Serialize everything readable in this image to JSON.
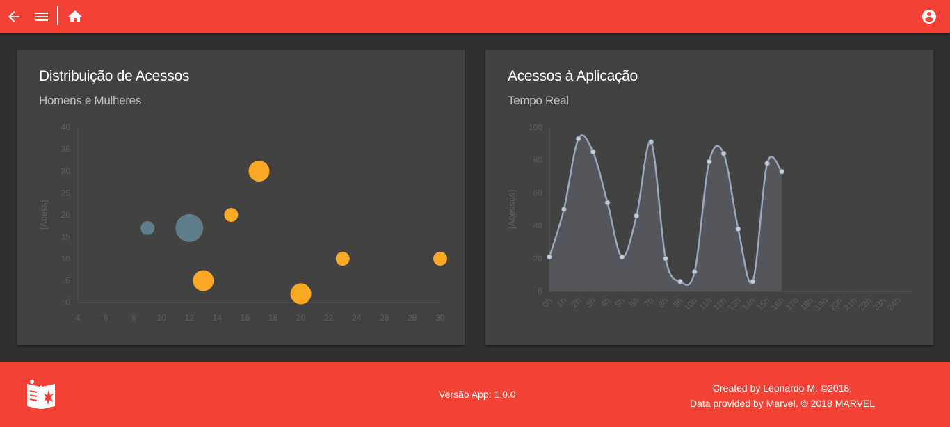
{
  "topbar": {
    "back_icon": "arrow-left-icon",
    "menu_icon": "menu-icon",
    "home_icon": "home-icon",
    "account_icon": "account-circle-icon"
  },
  "cards": {
    "left": {
      "title": "Distribuição de Acessos",
      "subtitle": "Homens e Mulheres"
    },
    "right": {
      "title": "Acessos à Aplicação",
      "subtitle": "Tempo Real"
    }
  },
  "footer": {
    "version": "Versão App: 1.0.0",
    "credit_line1": "Created by Leonardo M. ©2018.",
    "credit_line2": "Data provided by Marvel. © 2018 MARVEL"
  },
  "colors": {
    "primary": "#f44336",
    "card": "#424242",
    "background": "#303030",
    "bubble_blue": "#607d8b",
    "bubble_orange": "#f9a825",
    "line": "#9aa7bd",
    "area": "#54565b"
  },
  "chart_data": [
    {
      "type": "scatter",
      "title": "",
      "xlabel": "",
      "ylabel": "[Acess]",
      "xlim": [
        4,
        30
      ],
      "ylim": [
        0,
        40
      ],
      "x_ticks": [
        "4",
        "6",
        "8",
        "10",
        "12",
        "14",
        "16",
        "18",
        "20",
        "22",
        "24",
        "26",
        "28",
        "30"
      ],
      "y_ticks": [
        "0",
        "5",
        "10",
        "15",
        "20",
        "25",
        "30",
        "35",
        "40"
      ],
      "grid": false,
      "series": [
        {
          "color": "#607d8b",
          "points": [
            {
              "x": 9,
              "y": 17,
              "r": 10
            },
            {
              "x": 12,
              "y": 17,
              "r": 20
            }
          ]
        },
        {
          "color": "#f9a825",
          "points": [
            {
              "x": 13,
              "y": 5,
              "r": 15
            },
            {
              "x": 15,
              "y": 20,
              "r": 10
            },
            {
              "x": 17,
              "y": 30,
              "r": 15
            },
            {
              "x": 20,
              "y": 2,
              "r": 15
            },
            {
              "x": 23,
              "y": 10,
              "r": 10
            },
            {
              "x": 30,
              "y": 10,
              "r": 10
            }
          ]
        }
      ]
    },
    {
      "type": "area",
      "title": "",
      "xlabel": "",
      "ylabel": "[Acessos]",
      "ylim": [
        0,
        100
      ],
      "y_ticks": [
        "0",
        "20",
        "40",
        "60",
        "80",
        "100"
      ],
      "categories": [
        "0h",
        "1h",
        "2h",
        "3h",
        "4h",
        "5h",
        "6h",
        "7h",
        "8h",
        "9h",
        "10h",
        "11h",
        "12h",
        "13h",
        "14h",
        "15h",
        "16h",
        "17h",
        "18h",
        "19h",
        "20h",
        "21h",
        "22h",
        "23h",
        "24h"
      ],
      "values": [
        21,
        50,
        93,
        85,
        54,
        21,
        46,
        91,
        20,
        6,
        12,
        79,
        84,
        38,
        6,
        78,
        73
      ],
      "grid": false
    }
  ]
}
